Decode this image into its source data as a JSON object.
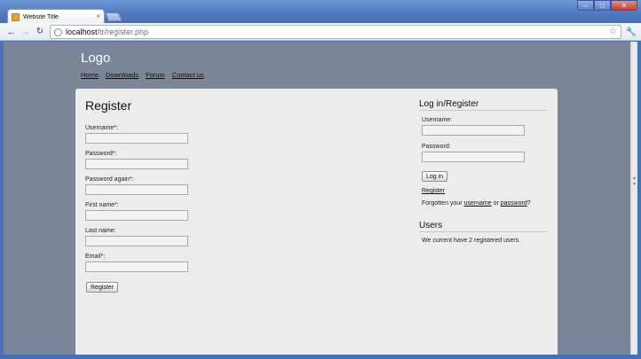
{
  "browser": {
    "tab_title": "Website Title",
    "tab_close": "×",
    "url_host": "localhost",
    "url_path": "/tr/register.php",
    "window_buttons": {
      "minimize": "–",
      "maximize": "□",
      "close": "✕"
    }
  },
  "site": {
    "logo": "Logo",
    "nav": [
      "Home",
      "Downloads",
      "Forum",
      "Contact us"
    ]
  },
  "register": {
    "title": "Register",
    "fields": [
      {
        "label": "Username*:",
        "value": ""
      },
      {
        "label": "Password*:",
        "value": ""
      },
      {
        "label": "Password again*:",
        "value": ""
      },
      {
        "label": "First name*:",
        "value": ""
      },
      {
        "label": "Last name:",
        "value": ""
      },
      {
        "label": "Email*:",
        "value": ""
      }
    ],
    "submit_label": "Register"
  },
  "login": {
    "title": "Log in/Register",
    "username_label": "Username:",
    "password_label": "Password:",
    "button_label": "Log in",
    "register_link": "Register",
    "forgot_prefix": "Forgotten your",
    "forgot_username": "username",
    "forgot_or": "or",
    "forgot_password": "password",
    "forgot_suffix": "?"
  },
  "users": {
    "title": "Users",
    "text": "We current have 2 registered users."
  },
  "icons": [
    "favicon-icon",
    "back-icon",
    "forward-icon",
    "reload-icon",
    "globe-icon",
    "star-icon",
    "wrench-icon"
  ],
  "colors": {
    "page_bg": "#7a8597",
    "content_bg": "#ececec",
    "frame": "#4a70b8"
  }
}
